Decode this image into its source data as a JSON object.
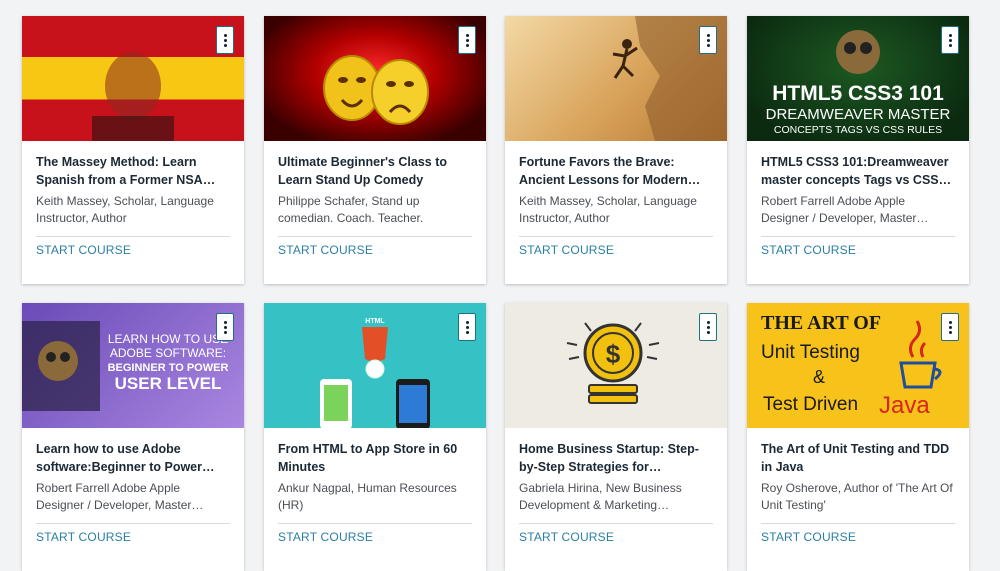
{
  "courses": [
    {
      "title": "The Massey Method: Learn Spanish from a Former NSA…",
      "author": "Keith Massey, Scholar, Language Instructor, Author",
      "cta": "START COURSE",
      "thumb": "spanish-flag-man"
    },
    {
      "title": "Ultimate Beginner's Class to Learn Stand Up Comedy",
      "author": "Philippe Schafer, Stand up comedian. Coach. Teacher.",
      "cta": "START COURSE",
      "thumb": "theater-masks"
    },
    {
      "title": "Fortune Favors the Brave: Ancient Lessons for Modern…",
      "author": "Keith Massey, Scholar, Language Instructor, Author",
      "cta": "START COURSE",
      "thumb": "cliff-climber"
    },
    {
      "title": "HTML5 CSS3 101:Dreamweaver master concepts Tags vs CSS…",
      "author": "Robert Farrell Adobe Apple Designer / Developer, Master…",
      "cta": "START COURSE",
      "thumb": "html5-css3",
      "thumb_text": {
        "line1": "HTML5 CSS3 101",
        "line2": "DREAMWEAVER MASTER",
        "line3": "CONCEPTS TAGS VS CSS RULES"
      }
    },
    {
      "title": "Learn how to use Adobe software:Beginner to Power…",
      "author": "Robert Farrell Adobe Apple Designer / Developer, Master…",
      "cta": "START COURSE",
      "thumb": "adobe-software",
      "thumb_text": {
        "line1": "LEARN HOW TO USE",
        "line2": "ADOBE SOFTWARE:",
        "line3": "BEGINNER TO POWER",
        "line4": "USER LEVEL"
      }
    },
    {
      "title": "From HTML to App Store in 60 Minutes",
      "author": "Ankur Nagpal, Human Resources (HR)",
      "cta": "START COURSE",
      "thumb": "html5-phones",
      "thumb_text": {
        "badge": "HTML"
      }
    },
    {
      "title": "Home Business Startup: Step-by-Step Strategies for…",
      "author": "Gabriela Hirina, New Business Development & Marketing…",
      "cta": "START COURSE",
      "thumb": "dollar-coin"
    },
    {
      "title": "The Art of Unit Testing and TDD in Java",
      "author": "Roy Osherove, Author of 'The Art Of Unit Testing'",
      "cta": "START COURSE",
      "thumb": "unit-testing-java",
      "thumb_text": {
        "line1": "THE ART OF",
        "line2": "Unit Testing",
        "line3": "&",
        "line4": "Test Driven",
        "line5": "Java"
      }
    }
  ],
  "menu_icon": "vertical-dots-icon",
  "colors": {
    "cta": "#2a7fa5",
    "title": "#1c2833",
    "menu_border": "#1f6f8b"
  }
}
